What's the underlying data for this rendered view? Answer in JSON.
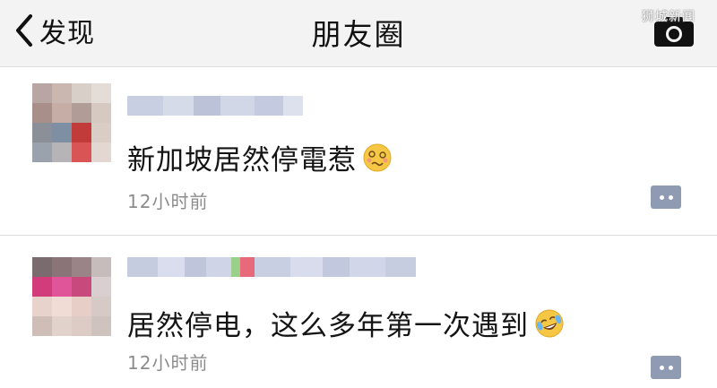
{
  "navbar": {
    "back_label": "发现",
    "title": "朋友圈",
    "watermark": "狮城新闻"
  },
  "posts": [
    {
      "text": "新加坡居然停電惹",
      "emoji": "woozy-face-icon",
      "timestamp": "12小时前"
    },
    {
      "text": "居然停电，这么多年第一次遇到",
      "emoji": "laughing-tears-face-icon",
      "timestamp": "12小时前"
    }
  ],
  "colors": {
    "navbar_bg": "#f3f3f3",
    "timestamp": "#8c8c8c",
    "comment_button": "#8f9bb3"
  }
}
